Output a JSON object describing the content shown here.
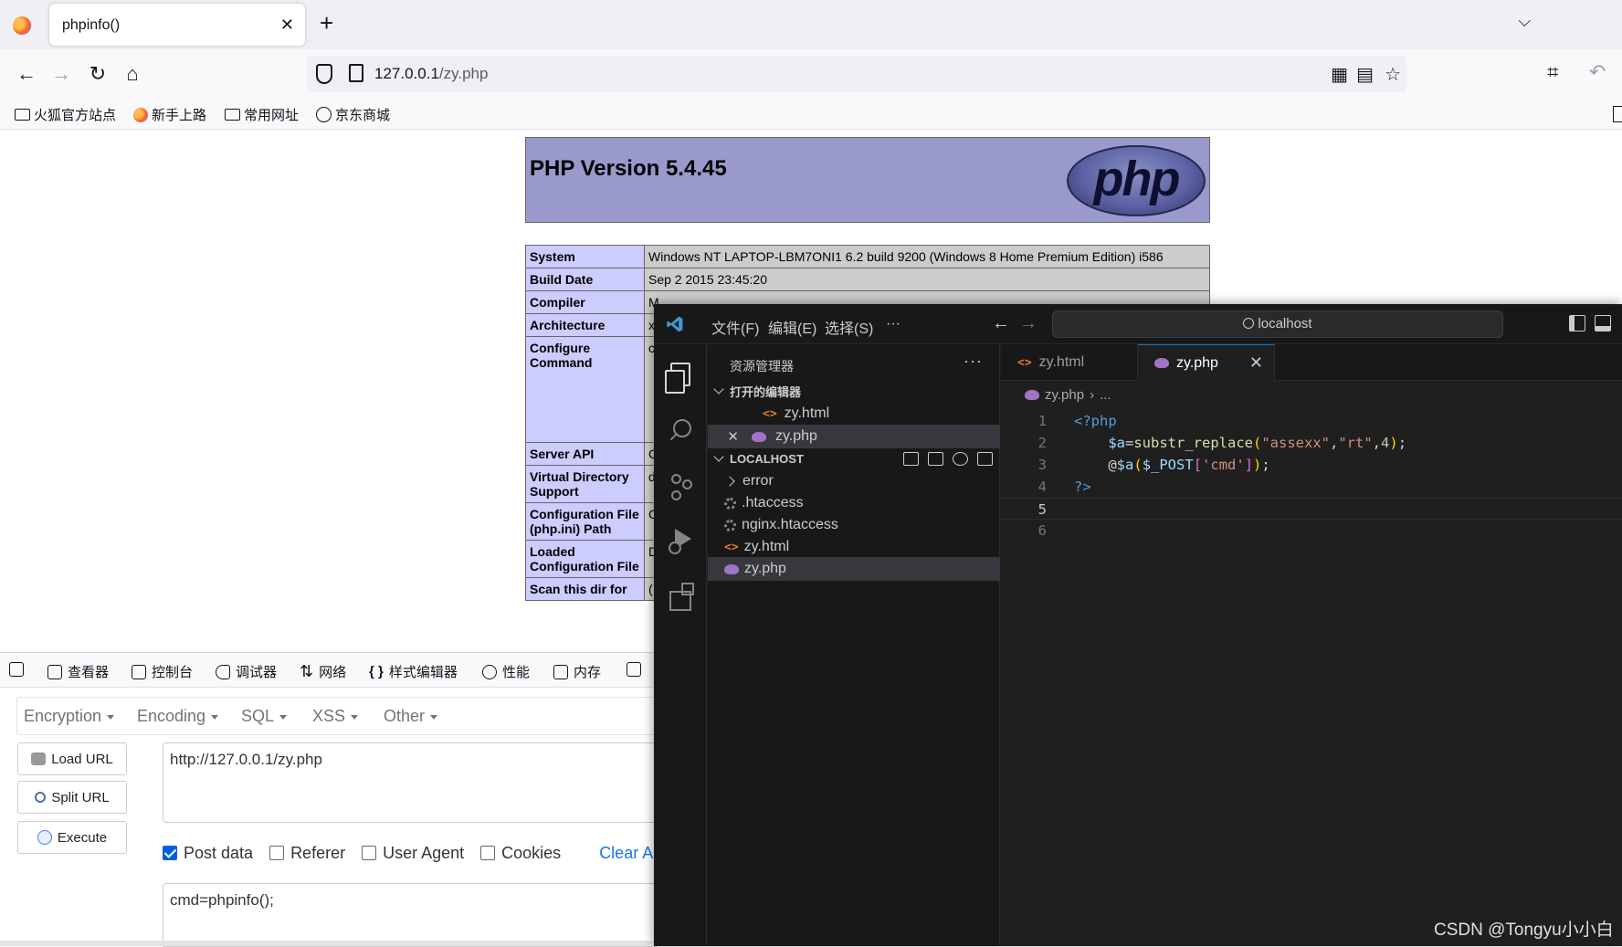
{
  "browser": {
    "tab_title": "phpinfo()",
    "tab_close": "✕",
    "new_tab": "+",
    "url_host": "127.0.0.1",
    "url_path": "/zy.php",
    "bookmarks": [
      "火狐官方站点",
      "新手上路",
      "常用网址",
      "京东商城"
    ]
  },
  "phpinfo": {
    "version": "PHP Version 5.4.45",
    "logo_text": "php",
    "rows": [
      {
        "key": "System",
        "value": "Windows NT LAPTOP-LBM7ONI1 6.2 build 9200 (Windows 8 Home Premium Edition) i586"
      },
      {
        "key": "Build Date",
        "value": "Sep 2 2015 23:45:20"
      },
      {
        "key": "Compiler",
        "value": "M"
      },
      {
        "key": "Architecture",
        "value": "x"
      },
      {
        "key": "Configure Command",
        "value": "c"
      },
      {
        "key": "Server API",
        "value": "C"
      },
      {
        "key": "Virtual Directory Support",
        "value": "d"
      },
      {
        "key": "Configuration File (php.ini) Path",
        "value": "C"
      },
      {
        "key": "Loaded Configuration File",
        "value": "D"
      },
      {
        "key": "Scan this dir for",
        "value": "("
      }
    ]
  },
  "devtools": {
    "tabs": [
      "查看器",
      "控制台",
      "调试器",
      "网络",
      "样式编辑器",
      "性能",
      "内存"
    ]
  },
  "hackbar": {
    "menus": [
      "Encryption",
      "Encoding",
      "SQL",
      "XSS",
      "Other"
    ],
    "load_url": "Load URL",
    "split_url": "Split URL",
    "execute": "Execute",
    "url_value": "http://127.0.0.1/zy.php",
    "checkboxes": [
      {
        "label": "Post data",
        "checked": true
      },
      {
        "label": "Referer",
        "checked": false
      },
      {
        "label": "User Agent",
        "checked": false
      },
      {
        "label": "Cookies",
        "checked": false
      }
    ],
    "clear_all": "Clear Al",
    "post_value": "cmd=phpinfo();"
  },
  "vscode": {
    "menus": [
      "文件(F)",
      "编辑(E)",
      "选择(S)",
      "···"
    ],
    "search_text": "localhost",
    "explorer_title": "资源管理器",
    "open_editors_label": "打开的编辑器",
    "open_editors": [
      "zy.html",
      "zy.php"
    ],
    "workspace_label": "LOCALHOST",
    "files": [
      "error",
      ".htaccess",
      "nginx.htaccess",
      "zy.html",
      "zy.php"
    ],
    "tabs": [
      "zy.html",
      "zy.php"
    ],
    "breadcrumb_file": "zy.php",
    "breadcrumb_more": "...",
    "line_numbers": [
      "1",
      "2",
      "3",
      "4",
      "5",
      "6"
    ]
  },
  "watermark": "CSDN @Tongyu小小白"
}
